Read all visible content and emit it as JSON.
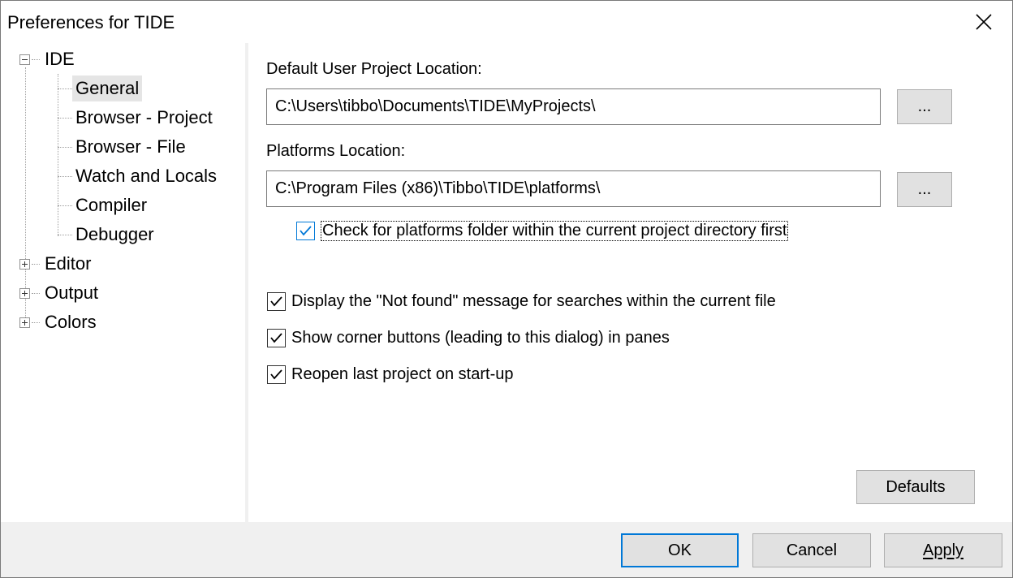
{
  "window": {
    "title": "Preferences for TIDE"
  },
  "tree": {
    "root": {
      "label": "IDE",
      "expanded": true
    },
    "children": [
      {
        "label": "General",
        "selected": true
      },
      {
        "label": "Browser - Project"
      },
      {
        "label": "Browser - File"
      },
      {
        "label": "Watch and Locals"
      },
      {
        "label": "Compiler"
      },
      {
        "label": "Debugger"
      }
    ],
    "collapsed": [
      {
        "label": "Editor"
      },
      {
        "label": "Output"
      },
      {
        "label": "Colors"
      }
    ]
  },
  "general": {
    "project_location_label": "Default User Project Location:",
    "project_location_value": "C:\\Users\\tibbo\\Documents\\TIDE\\MyProjects\\",
    "browse_label": "...",
    "platforms_location_label": "Platforms Location:",
    "platforms_location_value": "C:\\Program Files (x86)\\Tibbo\\TIDE\\platforms\\",
    "check_platforms_label": "Check for platforms folder within the current project directory first",
    "not_found_label": "Display the \"Not found\" message for searches within the current file",
    "corner_buttons_label": "Show corner buttons (leading to this dialog) in panes",
    "reopen_label": "Reopen last project on start-up",
    "defaults_label": "Defaults"
  },
  "footer": {
    "ok_label": "OK",
    "cancel_label": "Cancel",
    "apply_label": "Apply"
  },
  "colors": {
    "accent": "#0078d7",
    "selection": "#e5e5e5",
    "button_face": "#e1e1e1"
  }
}
